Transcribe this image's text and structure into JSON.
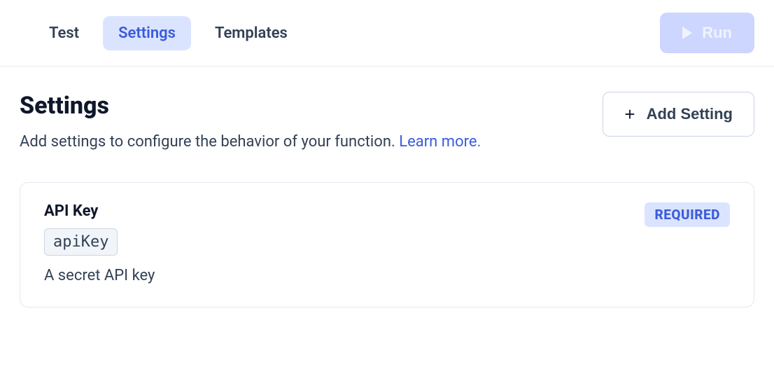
{
  "tabs": {
    "test": "Test",
    "settings": "Settings",
    "templates": "Templates"
  },
  "run": {
    "label": "Run"
  },
  "header": {
    "title": "Settings",
    "subtitle_prefix": "Add settings to configure the behavior of your function. ",
    "learn_more": "Learn more."
  },
  "add_button": {
    "label": "Add Setting"
  },
  "setting_card": {
    "title": "API Key",
    "code": "apiKey",
    "description": "A secret API key",
    "badge": "REQUIRED"
  }
}
